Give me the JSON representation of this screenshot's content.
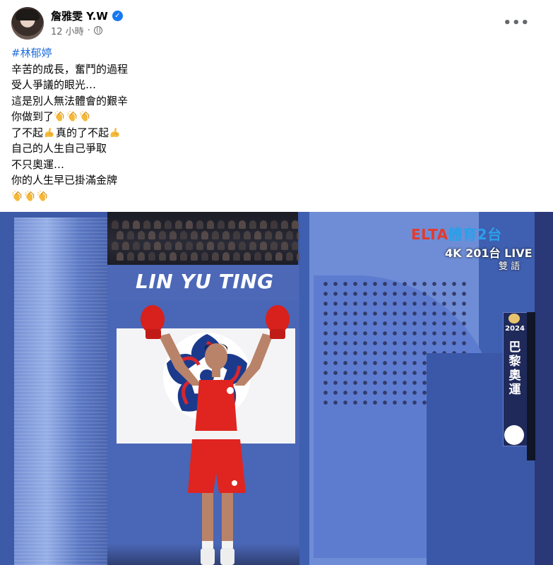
{
  "post": {
    "author": "詹雅雯 Y.W",
    "time": "12 小時",
    "separator": "·",
    "more_label": "•••",
    "verified_mark": "✓"
  },
  "text_lines": [
    {
      "text": "#林郁婷",
      "hashtag": true
    },
    {
      "text": "辛苦的成長，奮鬥的過程"
    },
    {
      "text": "受人爭議的眼光…"
    },
    {
      "text": "這是別人無法體會的艱辛"
    },
    {
      "text": "你做到了",
      "emoji": "clap",
      "count": 3
    },
    {
      "text": "了不起",
      "mid": "真的了不起",
      "emoji": "muscle"
    },
    {
      "text": "自己的人生自己爭取"
    },
    {
      "text": "不只奧運…"
    },
    {
      "text": "你的人生早已掛滿金牌"
    },
    {
      "text": "",
      "emoji": "clap",
      "count": 3
    }
  ],
  "media": {
    "banner_name": "LIN YU TING",
    "channel_logo_a": "ELTA",
    "channel_logo_b": "體育2台",
    "live_label": "4K 201台 LIVE",
    "bilingual": "雙 語",
    "olympics_year": "2024",
    "olympics_label": "巴黎奧運"
  },
  "colors": {
    "hashtag": "#216fdb",
    "verified": "#1877f2",
    "media_bg": "#3d5aa8",
    "jersey": "#e0241f"
  }
}
